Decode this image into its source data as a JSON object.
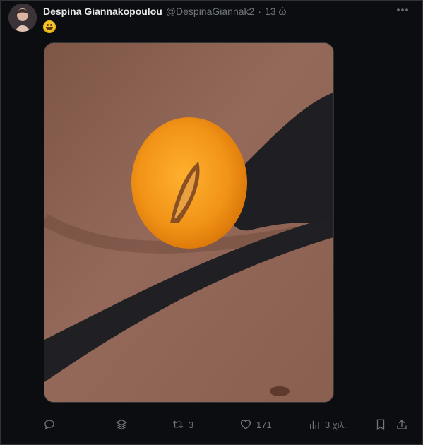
{
  "tweet": {
    "author_name": "Despina Giannakopoulou",
    "author_handle": "@DespinaGiannak2",
    "separator": "·",
    "time": "13 ώ",
    "avatar_icon": "profile-avatar",
    "emoji_icon": "grinning-face-emoji",
    "media_icon": "photo-peach-swimsuit"
  },
  "actions": {
    "reply": {
      "icon": "reply-icon",
      "count": ""
    },
    "grok": {
      "icon": "layers-icon"
    },
    "retweet": {
      "icon": "retweet-icon",
      "count": "3"
    },
    "like": {
      "icon": "heart-icon",
      "count": "171"
    },
    "views": {
      "icon": "views-icon",
      "count": "3 χιλ."
    },
    "bookmark": {
      "icon": "bookmark-icon"
    },
    "share": {
      "icon": "share-icon"
    }
  },
  "colors": {
    "background": "#0b0d10",
    "text": "#e7e9ea",
    "muted": "#71767b",
    "border": "#2f3336"
  }
}
